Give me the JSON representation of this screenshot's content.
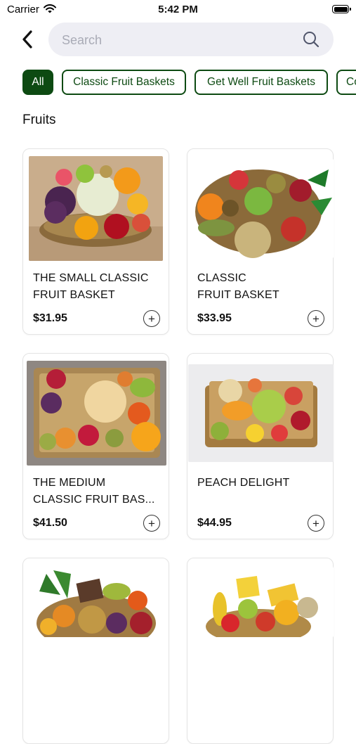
{
  "status_bar": {
    "carrier": "Carrier",
    "time": "5:42 PM"
  },
  "header": {
    "search_placeholder": "Search"
  },
  "categories": [
    {
      "label": "All",
      "active": true
    },
    {
      "label": "Classic Fruit Baskets",
      "active": false
    },
    {
      "label": "Get Well Fruit Baskets",
      "active": false
    },
    {
      "label": "Co",
      "active": false
    }
  ],
  "section_title": "Fruits",
  "products": [
    {
      "name_line1": "THE SMALL CLASSIC",
      "name_line2": "FRUIT BASKET",
      "price": "$31.95"
    },
    {
      "name_line1": "CLASSIC",
      "name_line2": "FRUIT BASKET",
      "price": "$33.95"
    },
    {
      "name_line1": "THE MEDIUM",
      "name_line2": "CLASSIC FRUIT BAS...",
      "price": "$41.50"
    },
    {
      "name_line1": "PEACH DELIGHT",
      "name_line2": "",
      "price": "$44.95"
    },
    {
      "name_line1": "",
      "name_line2": "",
      "price": ""
    },
    {
      "name_line1": "",
      "name_line2": "",
      "price": ""
    }
  ],
  "colors": {
    "accent": "#0d4a12",
    "search_bg": "#eeeef4",
    "placeholder": "#a9abb6"
  },
  "icons": [
    "wifi-icon",
    "battery-icon",
    "back-chevron-icon",
    "search-icon",
    "plus-icon"
  ]
}
